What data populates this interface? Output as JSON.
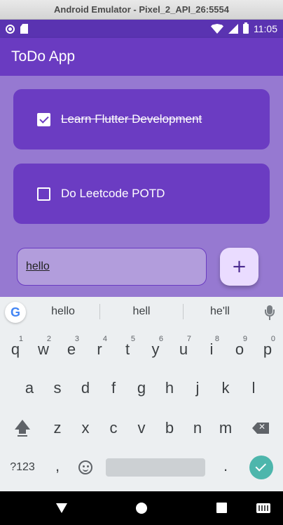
{
  "emulator": {
    "title": "Android Emulator - Pixel_2_API_26:5554"
  },
  "status_bar": {
    "time": "11:05",
    "icons": [
      "notification-icon",
      "sd-card-icon",
      "wifi-icon",
      "signal-icon",
      "battery-icon"
    ]
  },
  "app_bar": {
    "title": "ToDo App"
  },
  "todos": [
    {
      "label": "Learn Flutter Development",
      "checked": true
    },
    {
      "label": "Do Leetcode POTD",
      "checked": false
    }
  ],
  "input": {
    "value": "hello"
  },
  "add_button": {
    "label": "+"
  },
  "keyboard": {
    "suggestions": [
      "hello",
      "hell",
      "he'll"
    ],
    "row1": [
      {
        "key": "q",
        "hint": "1"
      },
      {
        "key": "w",
        "hint": "2"
      },
      {
        "key": "e",
        "hint": "3"
      },
      {
        "key": "r",
        "hint": "4"
      },
      {
        "key": "t",
        "hint": "5"
      },
      {
        "key": "y",
        "hint": "6"
      },
      {
        "key": "u",
        "hint": "7"
      },
      {
        "key": "i",
        "hint": "8"
      },
      {
        "key": "o",
        "hint": "9"
      },
      {
        "key": "p",
        "hint": "0"
      }
    ],
    "row2": [
      "a",
      "s",
      "d",
      "f",
      "g",
      "h",
      "j",
      "k",
      "l"
    ],
    "row3": [
      "z",
      "x",
      "c",
      "v",
      "b",
      "n",
      "m"
    ],
    "symbols_label": "?123",
    "comma": ",",
    "period": "."
  },
  "colors": {
    "app_bar": "#6a3bc1",
    "content_bg": "#9679d1",
    "card": "#6b3cc2",
    "enter_key": "#4db6ac"
  }
}
